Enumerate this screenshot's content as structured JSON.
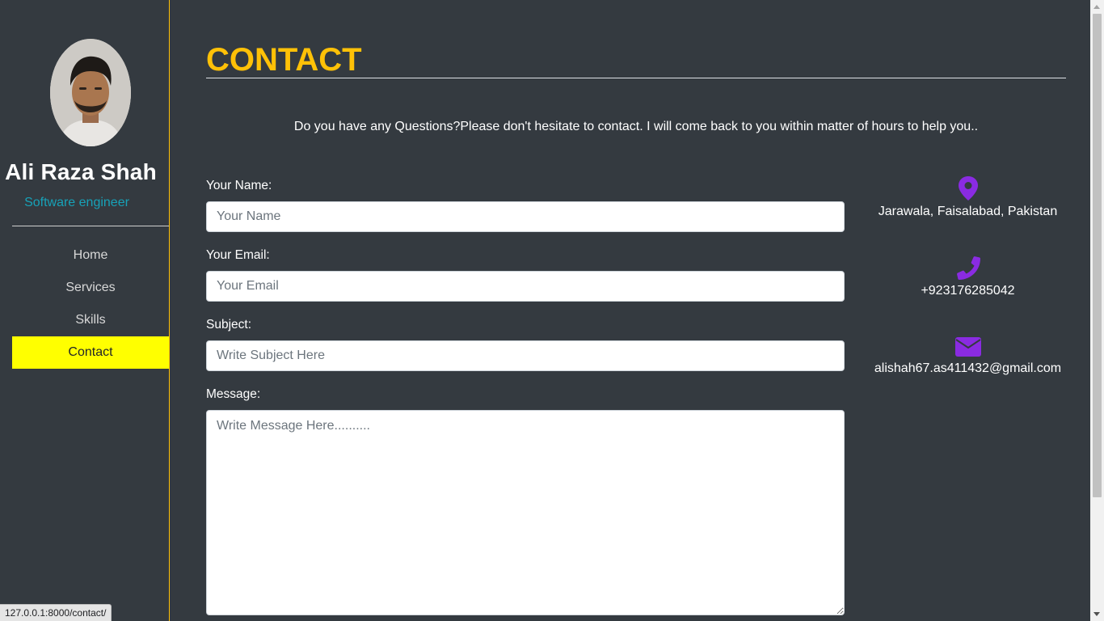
{
  "profile": {
    "name": "Ali Raza Shah",
    "role": "Software engineer"
  },
  "nav": {
    "items": [
      {
        "label": "Home"
      },
      {
        "label": "Services"
      },
      {
        "label": "Skills"
      },
      {
        "label": "Contact",
        "active": true
      }
    ]
  },
  "page": {
    "title": "CONTACT",
    "intro": "Do you have any Questions?Please don't hesitate to contact. I will come back to you within matter of hours to help you.."
  },
  "form": {
    "name_label": "Your Name:",
    "name_placeholder": "Your Name",
    "email_label": "Your Email:",
    "email_placeholder": "Your Email",
    "subject_label": "Subject:",
    "subject_placeholder": "Write Subject Here",
    "message_label": "Message:",
    "message_placeholder": "Write Message Here.........."
  },
  "contact_info": {
    "address": "Jarawala, Faisalabad, Pakistan",
    "address_icon": "map-marker-icon",
    "phone": "+923176285042",
    "phone_icon": "phone-icon",
    "email": "alishah67.as411432@gmail.com",
    "email_icon": "envelope-icon"
  },
  "status_bar": {
    "url": "127.0.0.1:8000/contact/"
  },
  "colors": {
    "background": "#343a40",
    "accent": "#ffc107",
    "active_nav": "#ffff00",
    "role_text": "#17a2b8",
    "icon": "#8a2be2"
  }
}
